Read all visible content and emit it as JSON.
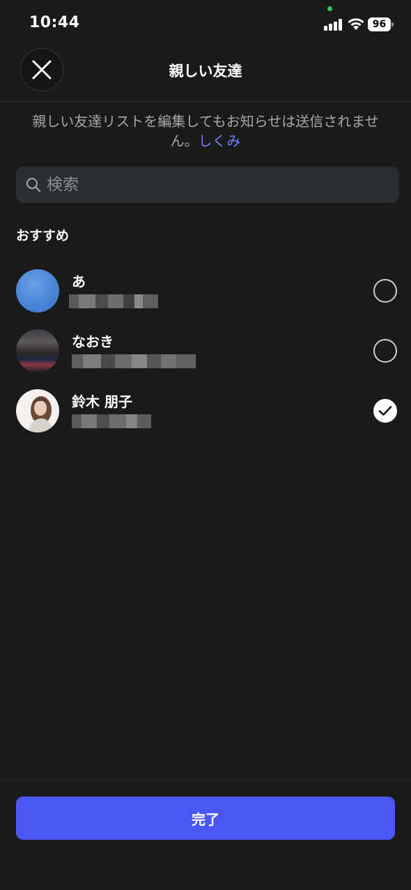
{
  "status_bar": {
    "time": "10:44",
    "battery": "96",
    "icons": [
      "cellular-signal-icon",
      "wifi-icon",
      "battery-icon"
    ]
  },
  "header": {
    "title": "親しい友達",
    "close_icon": "close-icon"
  },
  "description": {
    "text": "親しい友達リストを編集してもお知らせは送信されません。",
    "link": "しくみ"
  },
  "search": {
    "placeholder": "検索",
    "value": "",
    "icon": "search-icon"
  },
  "section": {
    "title": "おすすめ"
  },
  "contacts": [
    {
      "name": "あ",
      "selected": false,
      "avatar": "blue-sky-photo"
    },
    {
      "name": "なおき",
      "selected": false,
      "avatar": "night-city-photo"
    },
    {
      "name": "鈴木 朋子",
      "selected": true,
      "avatar": "woman-portrait-photo"
    }
  ],
  "footer": {
    "done_label": "完了"
  },
  "colors": {
    "background": "#1a1a1a",
    "accent": "#4a57f5",
    "link": "#6f80ff",
    "secondary_text": "#a8a8a8",
    "search_bg": "#2a2d31"
  }
}
